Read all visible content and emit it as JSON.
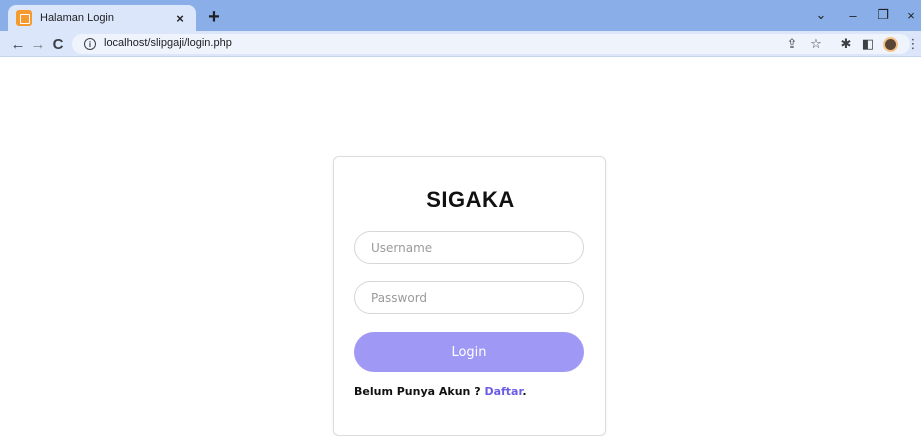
{
  "browser": {
    "tab_title": "Halaman Login",
    "tab_close": "×",
    "new_tab": "+",
    "url": "localhost/slipgaji/login.php",
    "icons": [
      "back-arrow-icon",
      "forward-arrow-icon",
      "reload-icon",
      "info-icon",
      "share-icon",
      "star-icon",
      "extensions-icon",
      "side-panel-icon",
      "profile-icon",
      "menu-icon"
    ],
    "window_controls": {
      "chevron": "⌄",
      "minimize": "–",
      "maximize": "❐",
      "close": "×"
    }
  },
  "login": {
    "title": "SIGAKA",
    "username_placeholder": "Username",
    "password_placeholder": "Password",
    "button_label": "Login",
    "register_prompt": "Belum Punya Akun ?",
    "register_link": "Daftar",
    "register_suffix": ".",
    "button_color": "#9f98f5",
    "link_color": "#6b5ce7"
  }
}
